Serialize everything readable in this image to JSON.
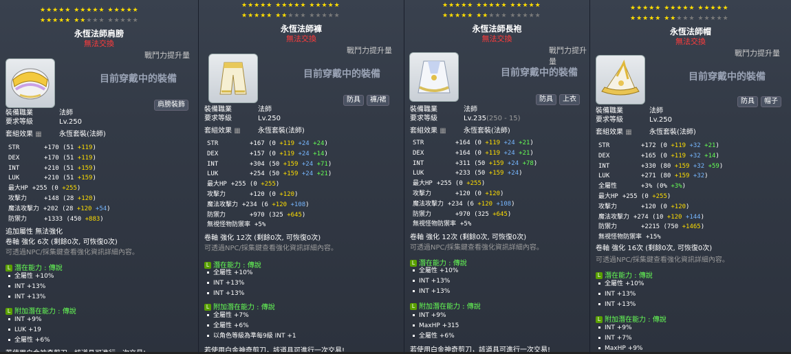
{
  "stars_top_row": "★★★★★  ★★★★★  ★★★★★",
  "stars_bottom_row_filled": "★★★★★  ★★",
  "stars_bottom_row_empty": "★★★  ★★★★★",
  "labels": {
    "untradeable": "無法交換",
    "atk_increase": "戰鬥力提升量",
    "currently_equipped": "目前穿戴中的裝備",
    "job_req": "裝備職業",
    "level_req": "要求等級",
    "job_value": "法師",
    "set_effect": "套組效果",
    "set_name": "永恆套裝(法師)",
    "potential": "潛在能力 : 傳說",
    "bonus_potential": "附加潛在能力 : 傳說",
    "scroll_hint": "可透過NPC/採集鍵查看強化資訊詳細內容。",
    "scissors": "若使用白金神奇剪刀，該道具可進行一次交易!"
  },
  "panels": [
    {
      "name": "永恆法師肩膀",
      "tags": [
        "肩膀裝飾"
      ],
      "level": "Lv.250",
      "stats": [
        [
          {
            "t": "STR"
          },
          {
            "t": "+170 (51 "
          },
          {
            "t": "+119",
            "c": "y"
          },
          {
            "t": ")"
          }
        ],
        [
          {
            "t": "DEX"
          },
          {
            "t": "+170 (51 "
          },
          {
            "t": "+119",
            "c": "y"
          },
          {
            "t": ")"
          }
        ],
        [
          {
            "t": "INT"
          },
          {
            "t": "+210 (51 "
          },
          {
            "t": "+159",
            "c": "y"
          },
          {
            "t": ")"
          }
        ],
        [
          {
            "t": "LUK"
          },
          {
            "t": "+210 (51 "
          },
          {
            "t": "+159",
            "c": "y"
          },
          {
            "t": ")"
          }
        ],
        [
          {
            "t": "最大HP"
          },
          {
            "t": "+255 (0 "
          },
          {
            "t": "+255",
            "c": "y"
          },
          {
            "t": ")"
          }
        ],
        [
          {
            "t": "攻擊力"
          },
          {
            "t": "+148 (28 "
          },
          {
            "t": "+120",
            "c": "y"
          },
          {
            "t": ")"
          }
        ],
        [
          {
            "t": "魔法攻擊力"
          },
          {
            "t": "+202 (28 "
          },
          {
            "t": "+120",
            "c": "y"
          },
          {
            "t": " "
          },
          {
            "t": "+54",
            "c": "b"
          },
          {
            "t": ")"
          }
        ],
        [
          {
            "t": "防禦力"
          },
          {
            "t": "+1333 (450 "
          },
          {
            "t": "+883",
            "c": "y"
          },
          {
            "t": ")"
          }
        ]
      ],
      "extra": "追加屬性  無法強化",
      "scroll": "卷軸 強化 6次 (剩餘0次, 可恢復0次)",
      "potentials": [
        "全屬性 +10%",
        "INT +13%",
        "INT +13%"
      ],
      "bonus": [
        "INT +9%",
        "LUK +19",
        "全屬性 +6%"
      ]
    },
    {
      "name": "永恆法師褲",
      "tags": [
        "防具",
        "褲/裙"
      ],
      "level": "Lv.250",
      "stats": [
        [
          {
            "t": "STR"
          },
          {
            "t": "+167 (0 "
          },
          {
            "t": "+119",
            "c": "y"
          },
          {
            "t": " "
          },
          {
            "t": "+24",
            "c": "b"
          },
          {
            "t": " "
          },
          {
            "t": "+24",
            "c": "gr"
          },
          {
            "t": ")"
          }
        ],
        [
          {
            "t": "DEX"
          },
          {
            "t": "+157 (0 "
          },
          {
            "t": "+119",
            "c": "y"
          },
          {
            "t": " "
          },
          {
            "t": "+24",
            "c": "b"
          },
          {
            "t": " "
          },
          {
            "t": "+14",
            "c": "gr"
          },
          {
            "t": ")"
          }
        ],
        [
          {
            "t": "INT"
          },
          {
            "t": "+304 (50 "
          },
          {
            "t": "+159",
            "c": "y"
          },
          {
            "t": " "
          },
          {
            "t": "+24",
            "c": "b"
          },
          {
            "t": " "
          },
          {
            "t": "+71",
            "c": "gr"
          },
          {
            "t": ")"
          }
        ],
        [
          {
            "t": "LUK"
          },
          {
            "t": "+254 (50 "
          },
          {
            "t": "+159",
            "c": "y"
          },
          {
            "t": " "
          },
          {
            "t": "+24",
            "c": "b"
          },
          {
            "t": " "
          },
          {
            "t": "+21",
            "c": "gr"
          },
          {
            "t": ")"
          }
        ],
        [
          {
            "t": "最大HP"
          },
          {
            "t": "+255 (0 "
          },
          {
            "t": "+255",
            "c": "y"
          },
          {
            "t": ")"
          }
        ],
        [
          {
            "t": "攻擊力"
          },
          {
            "t": "+120 (0 "
          },
          {
            "t": "+120",
            "c": "y"
          },
          {
            "t": ")"
          }
        ],
        [
          {
            "t": "魔法攻擊力"
          },
          {
            "t": "+234 (6 "
          },
          {
            "t": "+120",
            "c": "y"
          },
          {
            "t": " "
          },
          {
            "t": "+108",
            "c": "b"
          },
          {
            "t": ")"
          }
        ],
        [
          {
            "t": "防禦力"
          },
          {
            "t": "+970 (325 "
          },
          {
            "t": "+645",
            "c": "y"
          },
          {
            "t": ")"
          }
        ],
        [
          {
            "t": "無視怪物防禦率"
          },
          {
            "t": "+5%"
          }
        ]
      ],
      "scroll": "卷軸 強化 12次 (剩餘0次, 可恢復0次)",
      "potentials": [
        "全屬性 +10%",
        "INT +13%",
        "INT +13%"
      ],
      "bonus": [
        "全屬性 +7%",
        "全屬性 +6%",
        "以角色等級為準每9級 INT +1"
      ]
    },
    {
      "name": "永恆法師長袍",
      "tags": [
        "防具",
        "上衣"
      ],
      "level": "Lv.235",
      "level_extra": " (250 - 15)",
      "stats": [
        [
          {
            "t": "STR"
          },
          {
            "t": "+164 (0 "
          },
          {
            "t": "+119",
            "c": "y"
          },
          {
            "t": " "
          },
          {
            "t": "+24",
            "c": "b"
          },
          {
            "t": " "
          },
          {
            "t": "+21",
            "c": "gr"
          },
          {
            "t": ")"
          }
        ],
        [
          {
            "t": "DEX"
          },
          {
            "t": "+164 (0 "
          },
          {
            "t": "+119",
            "c": "y"
          },
          {
            "t": " "
          },
          {
            "t": "+24",
            "c": "b"
          },
          {
            "t": " "
          },
          {
            "t": "+21",
            "c": "gr"
          },
          {
            "t": ")"
          }
        ],
        [
          {
            "t": "INT"
          },
          {
            "t": "+311 (50 "
          },
          {
            "t": "+159",
            "c": "y"
          },
          {
            "t": " "
          },
          {
            "t": "+24",
            "c": "b"
          },
          {
            "t": " "
          },
          {
            "t": "+78",
            "c": "gr"
          },
          {
            "t": ")"
          }
        ],
        [
          {
            "t": "LUK"
          },
          {
            "t": "+233 (50 "
          },
          {
            "t": "+159",
            "c": "y"
          },
          {
            "t": " "
          },
          {
            "t": "+24",
            "c": "b"
          },
          {
            "t": ")"
          }
        ],
        [
          {
            "t": "最大HP"
          },
          {
            "t": "+255 (0 "
          },
          {
            "t": "+255",
            "c": "y"
          },
          {
            "t": ")"
          }
        ],
        [
          {
            "t": "攻擊力"
          },
          {
            "t": "+120 (0 "
          },
          {
            "t": "+120",
            "c": "y"
          },
          {
            "t": ")"
          }
        ],
        [
          {
            "t": "魔法攻擊力"
          },
          {
            "t": "+234 (6 "
          },
          {
            "t": "+120",
            "c": "y"
          },
          {
            "t": " "
          },
          {
            "t": "+108",
            "c": "b"
          },
          {
            "t": ")"
          }
        ],
        [
          {
            "t": "防禦力"
          },
          {
            "t": "+970 (325 "
          },
          {
            "t": "+645",
            "c": "y"
          },
          {
            "t": ")"
          }
        ],
        [
          {
            "t": "無視怪物防禦率"
          },
          {
            "t": "+5%"
          }
        ]
      ],
      "scroll": "卷軸 強化 12次 (剩餘0次, 可恢復0次)",
      "potentials": [
        "全屬性 +10%",
        "INT +13%",
        "INT +13%"
      ],
      "bonus": [
        "INT +9%",
        "MaxHP +315",
        "全屬性 +6%"
      ]
    },
    {
      "name": "永恆法師帽",
      "tags": [
        "防具",
        "帽子"
      ],
      "level": "Lv.250",
      "stats": [
        [
          {
            "t": "STR"
          },
          {
            "t": "+172 (0 "
          },
          {
            "t": "+119",
            "c": "y"
          },
          {
            "t": " "
          },
          {
            "t": "+32",
            "c": "b"
          },
          {
            "t": " "
          },
          {
            "t": "+21",
            "c": "gr"
          },
          {
            "t": ")"
          }
        ],
        [
          {
            "t": "DEX"
          },
          {
            "t": "+165 (0 "
          },
          {
            "t": "+119",
            "c": "y"
          },
          {
            "t": " "
          },
          {
            "t": "+32",
            "c": "b"
          },
          {
            "t": " "
          },
          {
            "t": "+14",
            "c": "gr"
          },
          {
            "t": ")"
          }
        ],
        [
          {
            "t": "INT"
          },
          {
            "t": "+330 (80 "
          },
          {
            "t": "+159",
            "c": "y"
          },
          {
            "t": " "
          },
          {
            "t": "+32",
            "c": "b"
          },
          {
            "t": " "
          },
          {
            "t": "+59",
            "c": "gr"
          },
          {
            "t": ")"
          }
        ],
        [
          {
            "t": "LUK"
          },
          {
            "t": "+271 (80 "
          },
          {
            "t": "+159",
            "c": "y"
          },
          {
            "t": " "
          },
          {
            "t": "+32",
            "c": "b"
          },
          {
            "t": ")"
          }
        ],
        [
          {
            "t": "全屬性"
          },
          {
            "t": "+3% (0% "
          },
          {
            "t": "+3%",
            "c": "gr"
          },
          {
            "t": ")"
          }
        ],
        [
          {
            "t": "最大HP"
          },
          {
            "t": "+255 (0 "
          },
          {
            "t": "+255",
            "c": "y"
          },
          {
            "t": ")"
          }
        ],
        [
          {
            "t": "攻擊力"
          },
          {
            "t": "+120 (0 "
          },
          {
            "t": "+120",
            "c": "y"
          },
          {
            "t": ")"
          }
        ],
        [
          {
            "t": "魔法攻擊力"
          },
          {
            "t": "+274 (10 "
          },
          {
            "t": "+120",
            "c": "y"
          },
          {
            "t": " "
          },
          {
            "t": "+144",
            "c": "b"
          },
          {
            "t": ")"
          }
        ],
        [
          {
            "t": "防禦力"
          },
          {
            "t": "+2215 (750 "
          },
          {
            "t": "+1465",
            "c": "y"
          },
          {
            "t": ")"
          }
        ],
        [
          {
            "t": "無視怪物防禦率"
          },
          {
            "t": "+15%"
          }
        ]
      ],
      "scroll": "卷軸 強化 16次 (剩餘0次, 可恢復0次)",
      "potentials": [
        "全屬性 +10%",
        "INT +13%",
        "INT +13%"
      ],
      "bonus": [
        "INT +9%",
        "INT +7%",
        "MaxHP +9%"
      ]
    }
  ]
}
